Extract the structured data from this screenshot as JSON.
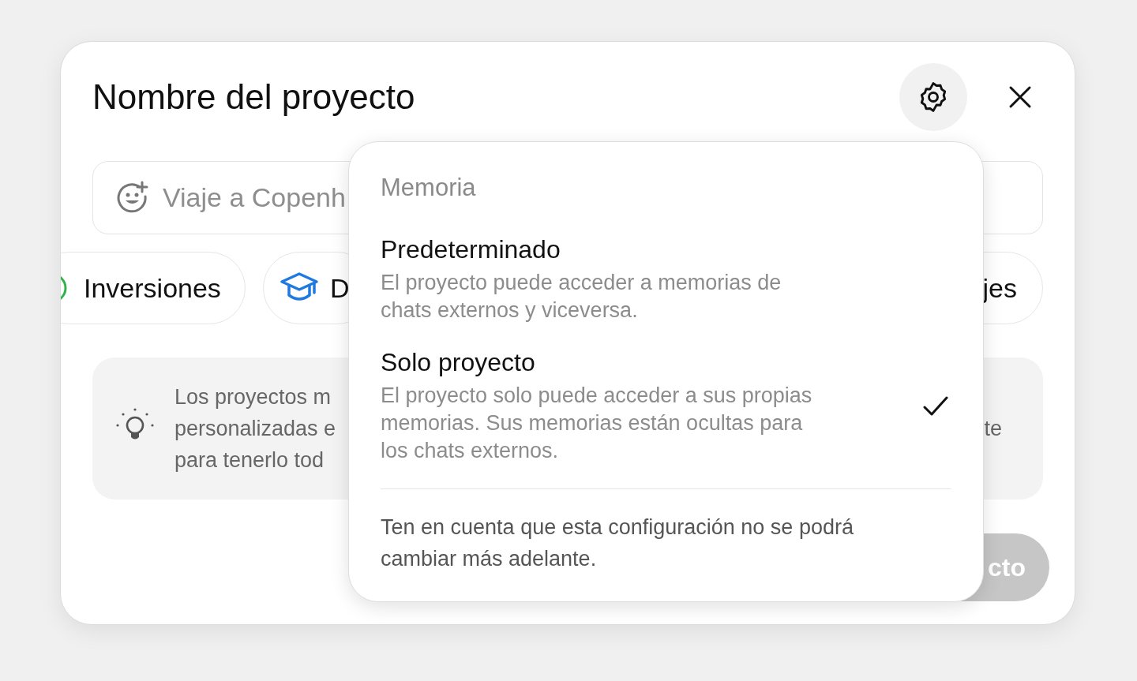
{
  "dialog": {
    "title": "Nombre del proyecto",
    "settings_button": {
      "pressed": true
    },
    "name_field": {
      "placeholder": "Viaje a Copenh"
    },
    "categories": [
      {
        "label": "Inversiones",
        "kind": "circle"
      },
      {
        "label": "D",
        "kind": "cap"
      },
      {
        "label": "jes",
        "kind": "plain"
      }
    ],
    "tip": {
      "lines": [
        "Los proyectos m",
        "personalizadas e",
        "para tenerlo tod"
      ],
      "right_text": "te"
    },
    "create_button": {
      "label": "cto",
      "disabled": true
    }
  },
  "memory_menu": {
    "heading": "Memoria",
    "options": [
      {
        "title": "Predeterminado",
        "description": "El proyecto puede acceder a memorias de chats externos y viceversa.",
        "selected": false
      },
      {
        "title": "Solo proyecto",
        "description": "El proyecto solo puede acceder a sus propias memorias. Sus memorias están ocultas para los chats externos.",
        "selected": true
      }
    ],
    "note": "Ten en cuenta que esta configuración no se podrá cambiar más adelante."
  }
}
